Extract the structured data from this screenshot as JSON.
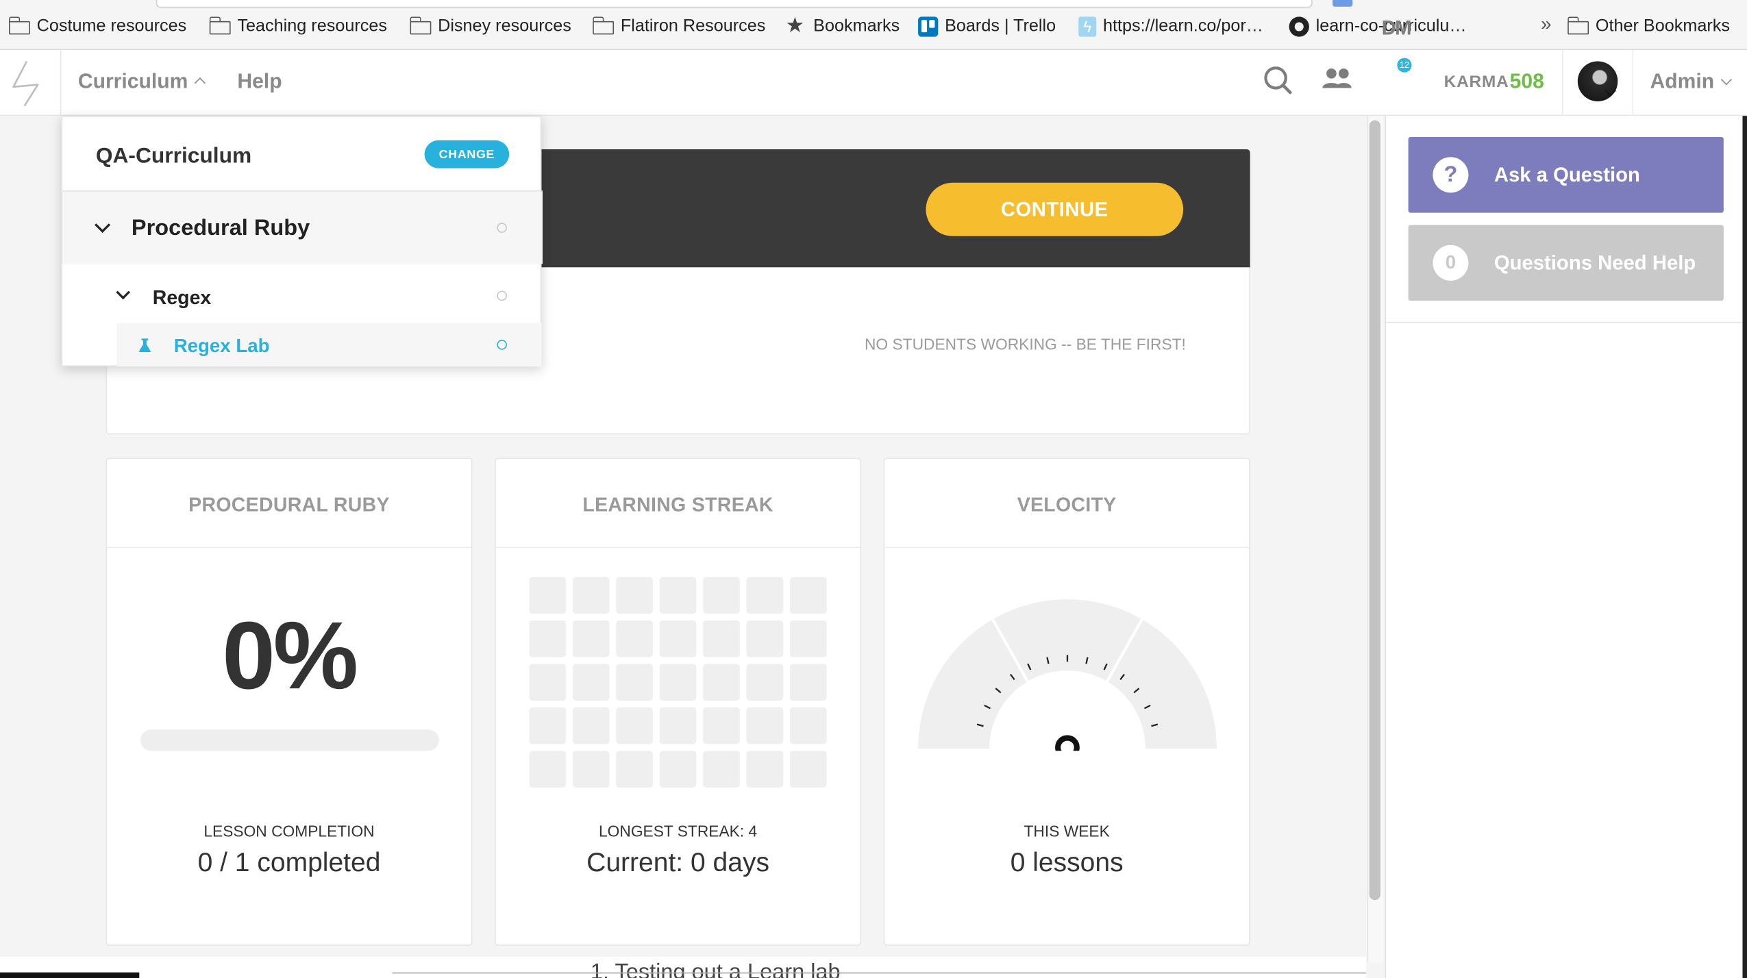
{
  "bookmarks": {
    "items": [
      {
        "label": "Costume resources",
        "icon": "folder-icon"
      },
      {
        "label": "Teaching resources",
        "icon": "folder-icon"
      },
      {
        "label": "Disney resources",
        "icon": "folder-icon"
      },
      {
        "label": "Flatiron Resources",
        "icon": "folder-icon"
      },
      {
        "label": "Bookmarks",
        "icon": "star-icon"
      },
      {
        "label": "Boards | Trello",
        "icon": "trello-icon"
      },
      {
        "label": "https://learn.co/por…",
        "icon": "learn-icon"
      },
      {
        "label": "learn-co-curriculu…",
        "icon": "github-icon"
      }
    ],
    "more": "»",
    "other": "Other Bookmarks"
  },
  "nav": {
    "curriculum": "Curriculum",
    "help": "Help",
    "dm": "DM",
    "dm_badge": "12",
    "karma_label": "KARMA",
    "karma_value": "508",
    "admin": "Admin"
  },
  "dropdown": {
    "title": "QA-Curriculum",
    "change": "CHANGE",
    "section": "Procedural Ruby",
    "subsection": "Regex",
    "lesson": "Regex Lab"
  },
  "hero": {
    "continue": "CONTINUE",
    "no_students": "NO STUDENTS WORKING -- BE THE FIRST!"
  },
  "cards": {
    "completion": {
      "title": "PROCEDURAL RUBY",
      "percent": "0%",
      "progress_fraction": 0,
      "label": "LESSON COMPLETION",
      "value": "0 / 1 completed"
    },
    "streak": {
      "title": "LEARNING STREAK",
      "label": "LONGEST STREAK: 4",
      "value": "Current: 0 days"
    },
    "velocity": {
      "title": "VELOCITY",
      "label": "THIS WEEK",
      "value": "0 lessons"
    }
  },
  "sidebar": {
    "ask_icon": "?",
    "ask": "Ask a Question",
    "need_count": "0",
    "need": "Questions Need Help"
  },
  "bottom": {
    "partial_text": "1. Testing out a Learn lab"
  },
  "colors": {
    "accent": "#27b2dd",
    "continue": "#f6bd2e",
    "karma": "#6cbe45",
    "ask": "#7d7cbc",
    "need_help": "#c9c9c9",
    "hero": "#3a3a3a"
  }
}
